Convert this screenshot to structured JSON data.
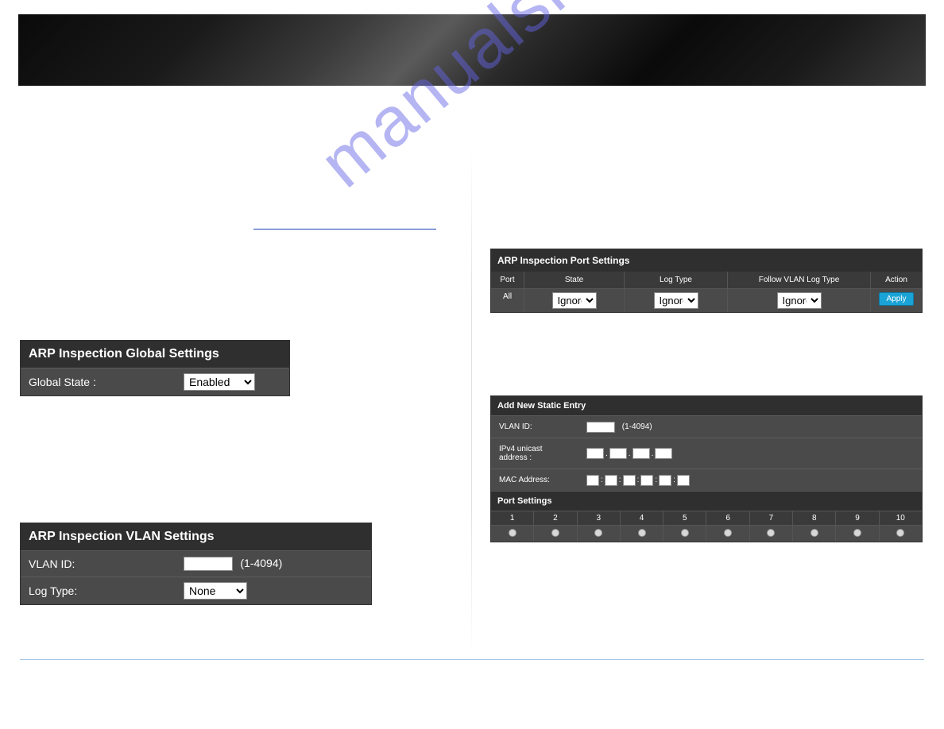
{
  "watermark": "manualshive.com",
  "global_panel": {
    "title": "ARP Inspection Global Settings",
    "state_label": "Global State :",
    "state_value": "Enabled"
  },
  "vlan_panel": {
    "title": "ARP Inspection VLAN Settings",
    "vlan_label": "VLAN ID:",
    "vlan_range": "(1-4094)",
    "log_label": "Log Type:",
    "log_value": "None"
  },
  "port_panel": {
    "title": "ARP Inspection Port Settings",
    "headers": {
      "port": "Port",
      "state": "State",
      "log_type": "Log Type",
      "follow": "Follow VLAN Log Type",
      "action": "Action"
    },
    "row": {
      "port": "All",
      "state": "Ignore",
      "log_type": "Ignore",
      "follow": "Ignore",
      "apply": "Apply"
    }
  },
  "static_panel": {
    "title": "Add New Static Entry",
    "vlan_label": "VLAN ID:",
    "vlan_range": "(1-4094)",
    "ipv4_label": "IPv4 unicast address :",
    "mac_label": "MAC Address:",
    "ports_title": "Port Settings",
    "ports": [
      "1",
      "2",
      "3",
      "4",
      "5",
      "6",
      "7",
      "8",
      "9",
      "10"
    ]
  }
}
